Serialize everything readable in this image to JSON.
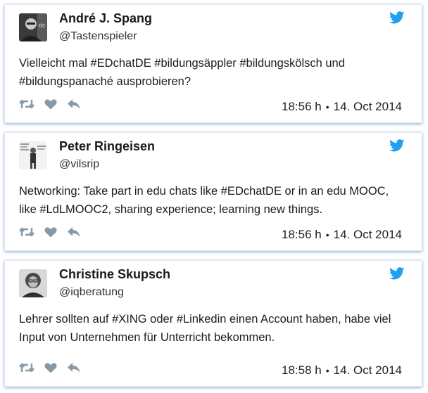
{
  "theme": {
    "card_shadow": "#6e96d2",
    "icon_color": "#8899a6",
    "bird_color": "#1da1f2"
  },
  "tweets": [
    {
      "name": "André J. Spang",
      "handle": "@Tastenspieler",
      "text_lines": [
        "Vielleicht mal #EDchatDE #bildungsäppler #bildungskölsch und",
        "#bildungspanaché ausprobieren?"
      ],
      "time": "18:56 h",
      "separator": "•",
      "date": "14. Oct 2014",
      "avatar_icon": "avatar-andre-photo",
      "action_icons": [
        "retweet-icon",
        "heart-icon",
        "reply-icon"
      ]
    },
    {
      "name": "Peter Ringeisen",
      "handle": "@vilsrip",
      "text_lines": [
        "Networking: Take part in edu chats like #EDchatDE or in an edu MOOC,",
        "like #LdLMOOC2, sharing experience; learning new things."
      ],
      "time": "18:56 h",
      "separator": "•",
      "date": "14. Oct 2014",
      "avatar_icon": "avatar-peter-photo",
      "action_icons": [
        "retweet-icon",
        "heart-icon",
        "reply-icon"
      ]
    },
    {
      "name": "Christine Skupsch",
      "handle": "@iqberatung",
      "text_lines": [
        "Lehrer sollten auf #XING oder #Linkedin einen Account haben, habe viel",
        "Input von Unternehmen für Unterricht bekommen."
      ],
      "time": "18:58 h",
      "separator": "•",
      "date": "14. Oct 2014",
      "avatar_icon": "avatar-christine-photo",
      "action_icons": [
        "retweet-icon",
        "heart-icon",
        "reply-icon"
      ]
    }
  ]
}
